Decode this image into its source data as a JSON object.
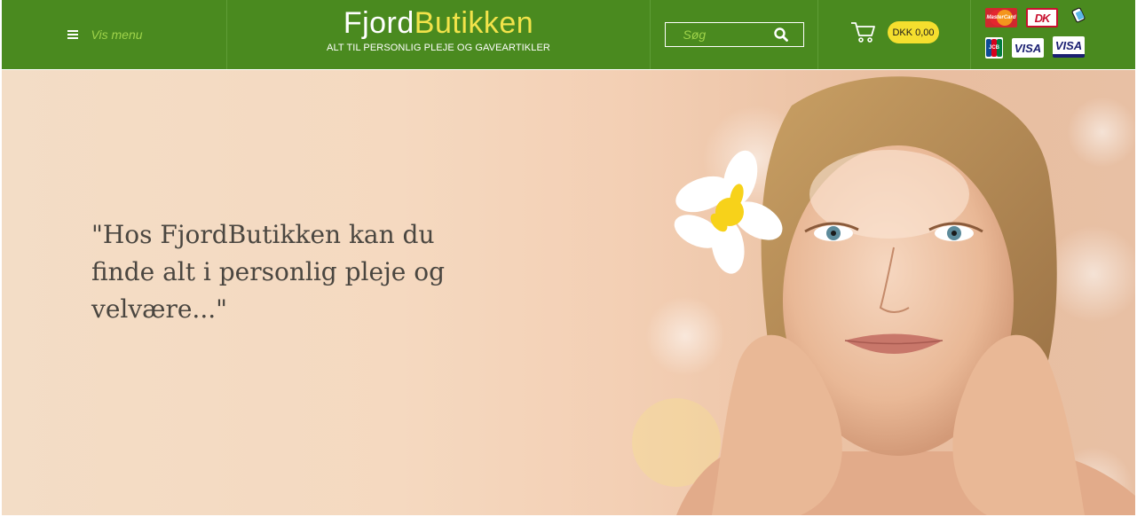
{
  "header": {
    "menu_label": "Vis menu",
    "logo_part1": "Fjord",
    "logo_part2": "Butikken",
    "tagline": "ALT TIL PERSONLIG PLEJE OG GAVEARTIKLER",
    "search_placeholder": "Søg",
    "cart_total": "DKK 0,00",
    "payment_cards": [
      {
        "name": "mastercard",
        "label": "MasterCard"
      },
      {
        "name": "dankort",
        "label": "DK"
      },
      {
        "name": "mobilepay",
        "label": ""
      },
      {
        "name": "jcb",
        "label": "JCB"
      },
      {
        "name": "visa",
        "label": "VISA"
      },
      {
        "name": "visa-electron",
        "label": "VISA"
      }
    ]
  },
  "hero": {
    "quote": "\"Hos FjordButikken kan du finde alt i personlig pleje og velvære...\""
  },
  "colors": {
    "header_bg": "#4a8a1f",
    "accent_green": "#9fd34a",
    "logo_yellow": "#f2e34a",
    "cart_badge": "#f5df2e"
  },
  "icons": {
    "menu": "hamburger-icon",
    "search": "search-icon",
    "cart": "cart-icon"
  }
}
